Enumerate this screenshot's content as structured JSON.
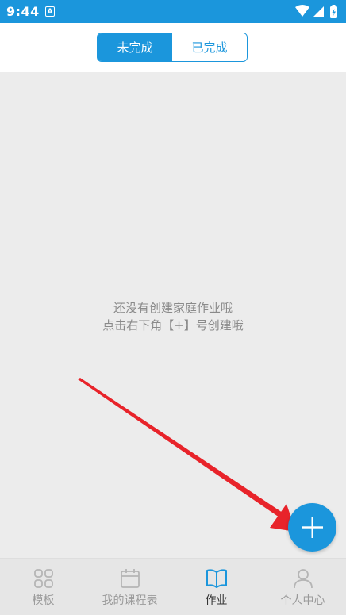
{
  "status_bar": {
    "time": "9:44",
    "notification_icon": "A",
    "icons": [
      "wifi-icon",
      "signal-icon",
      "battery-icon"
    ]
  },
  "segmented_control": {
    "tabs": [
      {
        "label": "未完成",
        "active": true
      },
      {
        "label": "已完成",
        "active": false
      }
    ]
  },
  "empty_state": {
    "line1": "还没有创建家庭作业哦",
    "line2": "点击右下角【+】号创建哦"
  },
  "fab": {
    "icon": "plus-icon"
  },
  "bottom_nav": {
    "items": [
      {
        "label": "模板",
        "icon": "grid-icon",
        "active": false
      },
      {
        "label": "我的课程表",
        "icon": "calendar-icon",
        "active": false
      },
      {
        "label": "作业",
        "icon": "book-icon",
        "active": true
      },
      {
        "label": "个人中心",
        "icon": "person-icon",
        "active": false
      }
    ]
  },
  "colors": {
    "accent": "#1b96dc",
    "annotation_arrow": "#e8232a",
    "background": "#ececec"
  }
}
